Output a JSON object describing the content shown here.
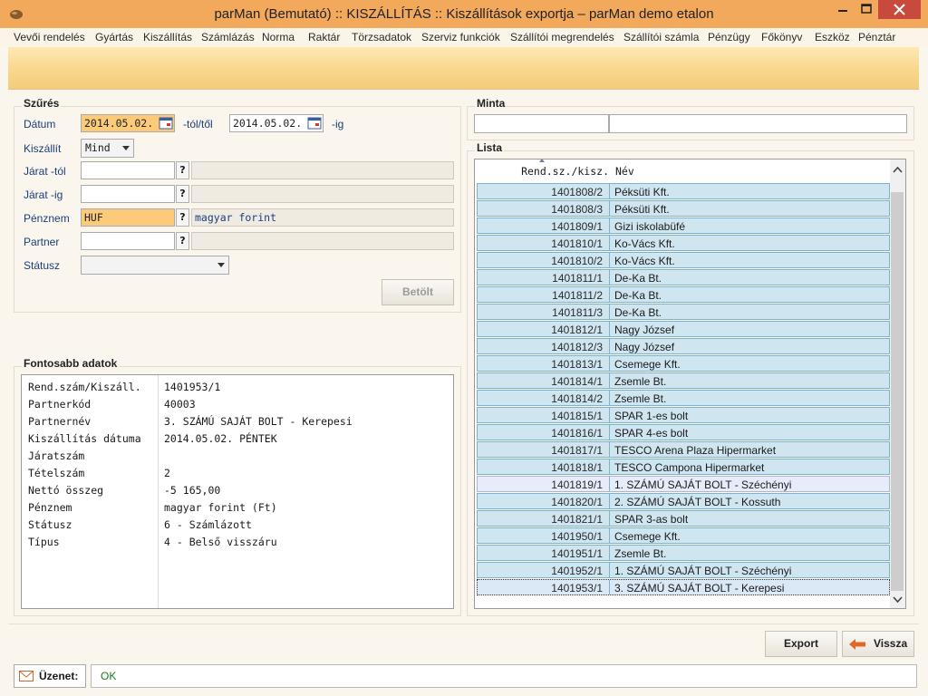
{
  "window": {
    "title": "parMan (Bemutató) :: KISZÁLLÍTÁS :: Kiszállítások exportja   –   parMan demo etalon"
  },
  "menu": [
    "Vevői rendelés",
    "Gyártás",
    "Kiszállítás",
    "Számlázás",
    "Norma",
    "Raktár",
    "Törzsadatok",
    "Szerviz funkciók",
    "Szállítói megrendelés",
    "Szállítói számla",
    "Pénzügy",
    "Főkönyv",
    "Eszköz",
    "Pénztár"
  ],
  "filter": {
    "group_title": "Szűrés",
    "date_label": "Dátum",
    "date_from": "2014.05.02.",
    "date_from_suffix": "-tól/től",
    "date_to": "2014.05.02.",
    "date_to_suffix": "-ig",
    "deliver_label": "Kiszállít",
    "deliver_value": "Mind",
    "route_from_label": "Járat -tól",
    "route_from_value": "",
    "route_to_label": "Járat -ig",
    "route_to_value": "",
    "currency_label": "Pénznem",
    "currency_value": "HUF",
    "currency_desc": "magyar forint",
    "partner_label": "Partner",
    "partner_value": "",
    "status_label": "Státusz",
    "status_value": "",
    "lookup_symbol": "?",
    "load_button": "Betölt"
  },
  "details": {
    "group_title": "Fontosabb adatok",
    "rows": [
      {
        "key": "Rend.szám/Kiszáll.",
        "value": "1401953/1"
      },
      {
        "key": "Partnerkód",
        "value": "40003"
      },
      {
        "key": "Partnernév",
        "value": "3. SZÁMÚ SAJÁT BOLT - Kerepesi"
      },
      {
        "key": "Kiszállítás dátuma",
        "value": "2014.05.02. PÉNTEK"
      },
      {
        "key": "Járatszám",
        "value": ""
      },
      {
        "key": "Tételszám",
        "value": "2"
      },
      {
        "key": "Nettó összeg",
        "value": "-5 165,00"
      },
      {
        "key": "Pénznem",
        "value": "magyar forint (Ft)"
      },
      {
        "key": "Státusz",
        "value": "6 - Számlázott"
      },
      {
        "key": "Típus",
        "value": "4 - Belső visszáru"
      }
    ]
  },
  "sample": {
    "group_title": "Minta",
    "value_1": "",
    "value_2": ""
  },
  "list": {
    "group_title": "Lista",
    "col_order": "Rend.sz./kisz.",
    "col_name": "Név",
    "rows": [
      {
        "order": "1401808/2",
        "name": "Péksüti Kft."
      },
      {
        "order": "1401808/3",
        "name": "Péksüti Kft."
      },
      {
        "order": "1401809/1",
        "name": "Gizi iskolabüfé"
      },
      {
        "order": "1401810/1",
        "name": "Ko-Vács Kft."
      },
      {
        "order": "1401810/2",
        "name": "Ko-Vács Kft."
      },
      {
        "order": "1401811/1",
        "name": "De-Ka Bt."
      },
      {
        "order": "1401811/2",
        "name": "De-Ka Bt."
      },
      {
        "order": "1401811/3",
        "name": "De-Ka Bt."
      },
      {
        "order": "1401812/1",
        "name": "Nagy József"
      },
      {
        "order": "1401812/3",
        "name": "Nagy József"
      },
      {
        "order": "1401813/1",
        "name": "Csemege Kft."
      },
      {
        "order": "1401814/1",
        "name": "Zsemle Bt."
      },
      {
        "order": "1401814/2",
        "name": "Zsemle Bt."
      },
      {
        "order": "1401815/1",
        "name": "SPAR 1-es bolt"
      },
      {
        "order": "1401816/1",
        "name": "SPAR 4-es bolt"
      },
      {
        "order": "1401817/1",
        "name": "TESCO Arena Plaza Hipermarket"
      },
      {
        "order": "1401818/1",
        "name": "TESCO Campona Hipermarket"
      },
      {
        "order": "1401819/1",
        "name": "1. SZÁMÚ SAJÁT BOLT - Széchényi"
      },
      {
        "order": "1401820/1",
        "name": "2. SZÁMÚ SAJÁT BOLT - Kossuth"
      },
      {
        "order": "1401821/1",
        "name": "SPAR 3-as bolt"
      },
      {
        "order": "1401950/1",
        "name": "Csemege Kft."
      },
      {
        "order": "1401951/1",
        "name": "Zsemle Bt."
      },
      {
        "order": "1401952/1",
        "name": "1. SZÁMÚ SAJÁT BOLT - Széchényi"
      },
      {
        "order": "1401953/1",
        "name": "3. SZÁMÚ SAJÁT BOLT - Kerepesi"
      }
    ]
  },
  "actions": {
    "export": "Export",
    "back": "Vissza"
  },
  "status": {
    "message_label": "Üzenet:",
    "message": "OK"
  },
  "colors": {
    "titlebar": "#f2a95c",
    "highlight_input": "#fccb7a",
    "list_row": "#cfe6f1",
    "close_button": "#c74a3d",
    "status_ok": "#1e7a1e"
  }
}
